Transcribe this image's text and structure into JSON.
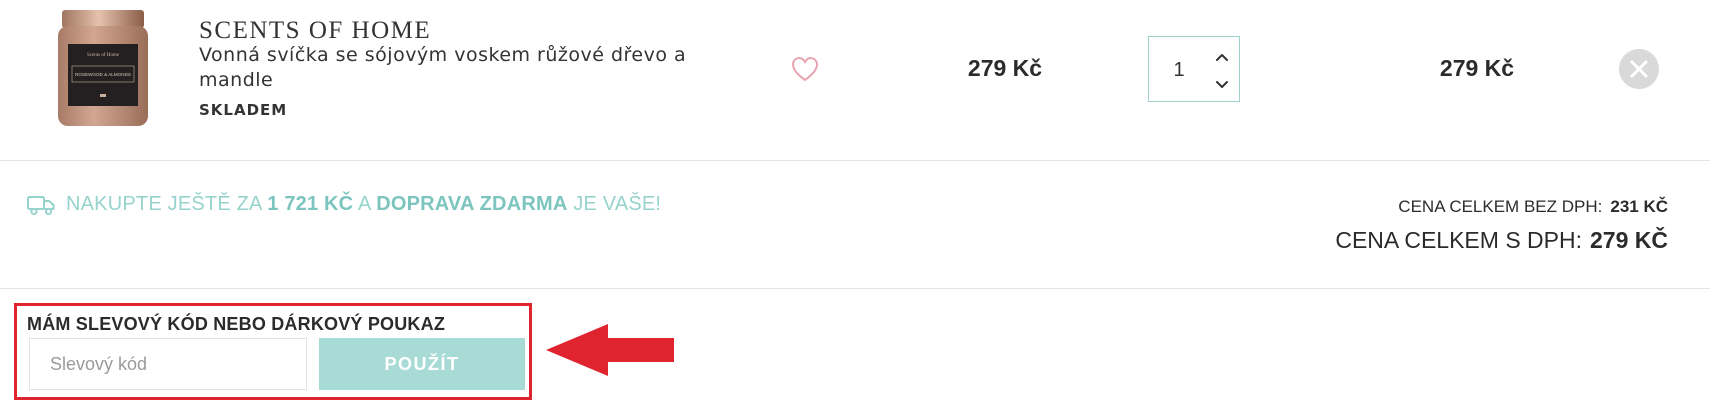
{
  "cart_item": {
    "brand": "SCENTS OF HOME",
    "name": "Vonná svíčka se sójovým voskem růžové dřevo a mandle",
    "stock": "SKLADEM",
    "image_label_small": "Scents of Home",
    "image_label_main": "ROSEWOOD & ALMONDS",
    "unit_price": "279 Kč",
    "quantity": "1",
    "total_price": "279 Kč",
    "icons": {
      "wishlist": "heart-icon",
      "qty_up": "chevron-up-icon",
      "qty_down": "chevron-down-icon",
      "remove": "close-icon"
    }
  },
  "shipping": {
    "icon": "truck-icon",
    "text_before": "NAKUPTE JEŠTĚ ZA",
    "amount": "1 721 KČ",
    "text_middle": "A",
    "highlight": "DOPRAVA ZDARMA",
    "text_after": "JE VAŠE!"
  },
  "totals": {
    "without_vat_label": "CENA CELKEM BEZ DPH:",
    "without_vat_value": "231 KČ",
    "with_vat_label": "CENA CELKEM S DPH:",
    "with_vat_value": "279 KČ"
  },
  "coupon": {
    "label": "MÁM SLEVOVÝ KÓD NEBO DÁRKOVÝ POUKAZ",
    "placeholder": "Slevový kód",
    "apply_label": "POUŽÍT"
  },
  "colors": {
    "accent": "#96d3cd",
    "button": "#a8dbd6",
    "highlight_border": "#e0242f",
    "arrow": "#e0242f",
    "heart": "#e8a3b0"
  }
}
